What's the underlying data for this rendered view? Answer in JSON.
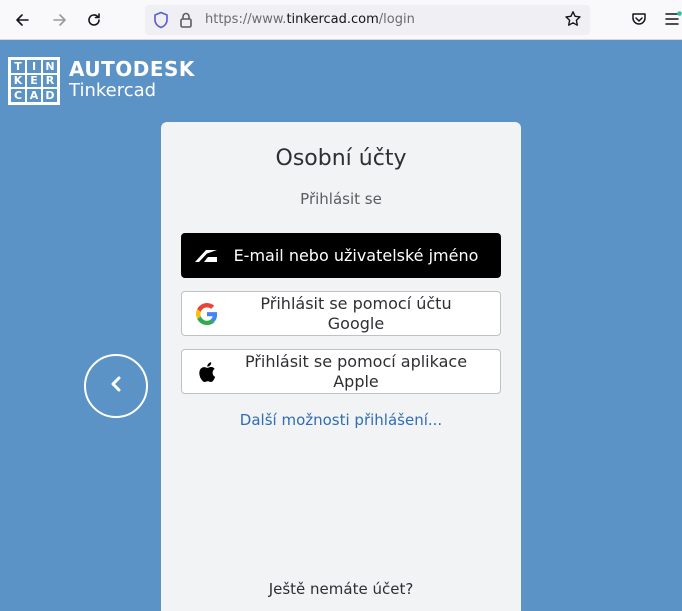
{
  "browser": {
    "url_prefix": "https://www.",
    "url_domain": "tinkercad.com",
    "url_path": "/login"
  },
  "brand": {
    "logo_letters": [
      "TIN",
      "KER",
      "CAD"
    ],
    "company": "AUTODESK",
    "product": "Tinkercad"
  },
  "card": {
    "title": "Osobní účty",
    "subtitle": "Přihlásit se",
    "buttons": [
      {
        "label": "E-mail nebo uživatelské jméno",
        "icon": "autodesk-icon"
      },
      {
        "label": "Přihlásit se pomocí účtu Google",
        "icon": "google-icon"
      },
      {
        "label": "Přihlásit se pomocí aplikace Apple",
        "icon": "apple-icon"
      }
    ],
    "more_options": "Další možnosti přihlášení...",
    "no_account": "Ještě nemáte účet?"
  },
  "colors": {
    "background": "#5b93c7",
    "card": "#f2f3f5",
    "link": "#2f6db5",
    "primary_button": "#000000"
  }
}
